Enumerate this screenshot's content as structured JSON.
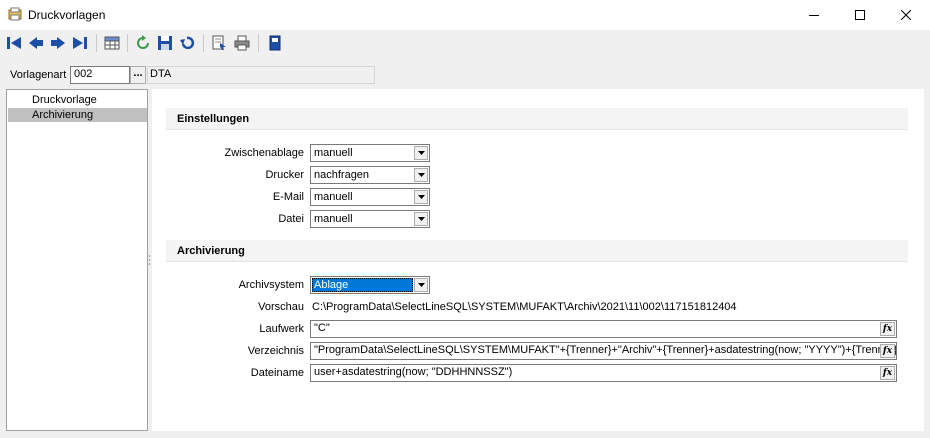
{
  "window": {
    "title": "Druckvorlagen"
  },
  "vorlagenart": {
    "label": "Vorlagenart",
    "code": "002",
    "lookup_label": "...",
    "name": "DTA"
  },
  "nav": {
    "items": [
      {
        "label": "Druckvorlage"
      },
      {
        "label": "Archivierung"
      }
    ]
  },
  "einstellungen": {
    "header": "Einstellungen",
    "rows": [
      {
        "label": "Zwischenablage",
        "value": "manuell"
      },
      {
        "label": "Drucker",
        "value": "nachfragen"
      },
      {
        "label": "E-Mail",
        "value": "manuell"
      },
      {
        "label": "Datei",
        "value": "manuell"
      }
    ]
  },
  "archivierung": {
    "header": "Archivierung",
    "archivsystem": {
      "label": "Archivsystem",
      "value": "Ablage"
    },
    "vorschau": {
      "label": "Vorschau",
      "value": "C:\\ProgramData\\SelectLineSQL\\SYSTEM\\MUFAKT\\Archiv\\2021\\11\\002\\117151812404"
    },
    "laufwerk": {
      "label": "Laufwerk",
      "value": "\"C\""
    },
    "verzeichnis": {
      "label": "Verzeichnis",
      "value": "\"ProgramData\\SelectLineSQL\\SYSTEM\\MUFAKT\"+{Trenner}+\"Archiv\"+{Trenner}+asdatestring(now; \"YYYY\")+{Trenner}+asdatestring(now; \"MM\")"
    },
    "dateiname": {
      "label": "Dateiname",
      "value": "user+asdatestring(now; \"DDHHNNSSZ\")"
    }
  },
  "colors": {
    "accent": "#0078d7",
    "selected_nav": "#c0c0c0",
    "toolbar_blue": "#1e4fa8"
  }
}
